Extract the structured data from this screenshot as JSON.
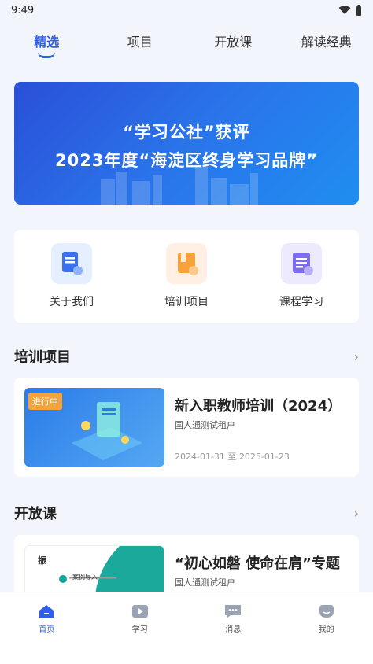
{
  "status_bar": {
    "time": "9:49"
  },
  "top_tabs": [
    {
      "label": "精选"
    },
    {
      "label": "项目"
    },
    {
      "label": "开放课"
    },
    {
      "label": "解读经典"
    }
  ],
  "banner": {
    "line1": "“学习公社”获评",
    "line2": "2023年度“海淀区终身学习品牌”"
  },
  "quick_links": [
    {
      "label": "关于我们",
      "icon": "document-icon"
    },
    {
      "label": "培训项目",
      "icon": "training-book-icon"
    },
    {
      "label": "课程学习",
      "icon": "course-list-icon"
    }
  ],
  "training_section": {
    "title": "培训项目",
    "course": {
      "badge": "进行中",
      "title": "新入职教师培训（2024）",
      "org": "国人通测试租户",
      "date": "2024-01-31 至 2025-01-23"
    }
  },
  "open_section": {
    "title": "开放课",
    "course": {
      "title": "“初心如磐 使命在肩”专题",
      "org": "国人通测试租户",
      "thumb_text1": "振",
      "thumb_text2": "案例导入"
    }
  },
  "bottom_nav": [
    {
      "label": "首页",
      "icon": "home-icon"
    },
    {
      "label": "学习",
      "icon": "study-icon"
    },
    {
      "label": "消息",
      "icon": "message-icon"
    },
    {
      "label": "我的",
      "icon": "profile-icon"
    }
  ],
  "colors": {
    "accent": "#2f5fe8",
    "badge": "#f6a23a"
  }
}
